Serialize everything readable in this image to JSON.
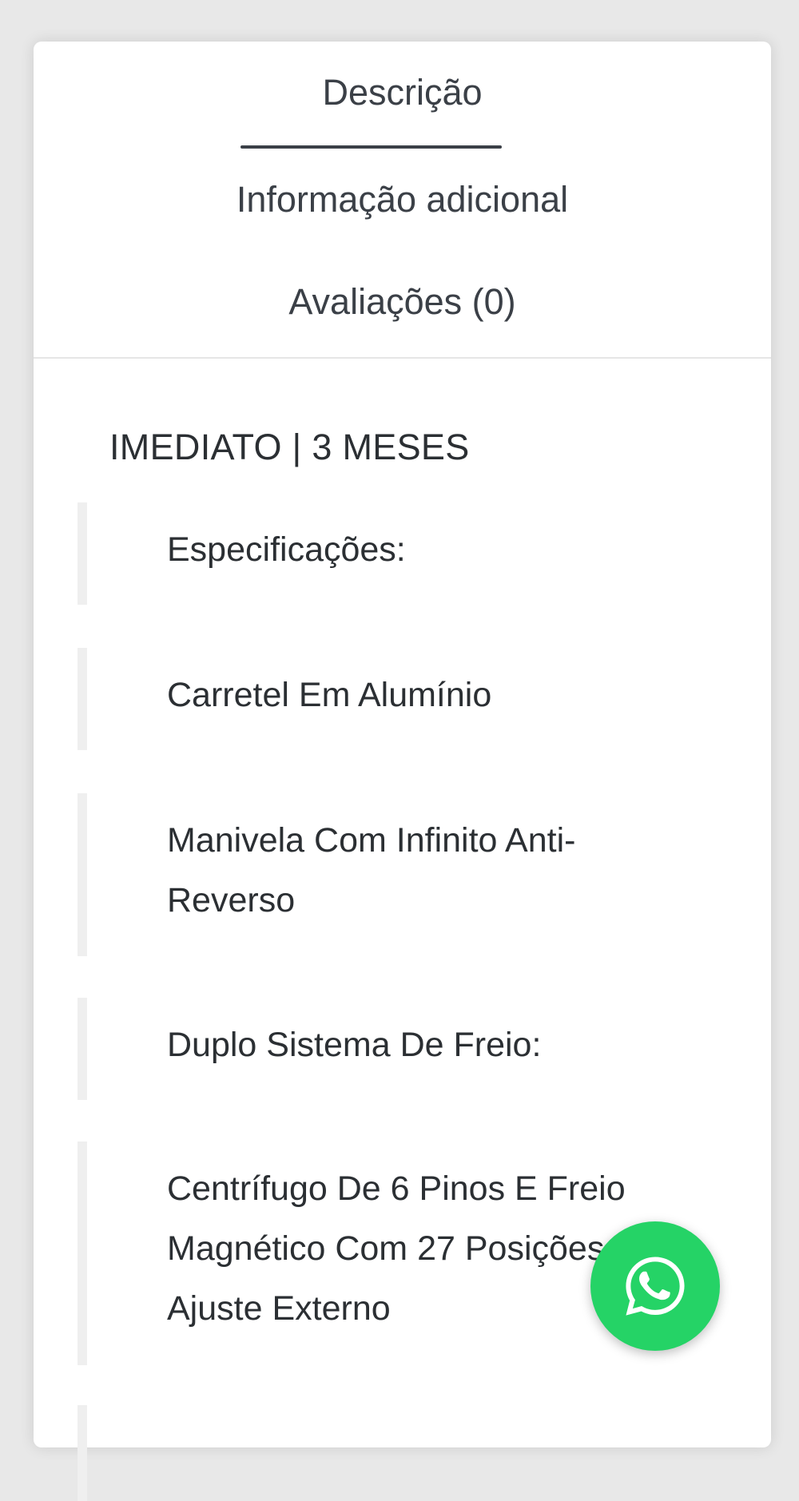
{
  "tabs": {
    "description": "Descrição",
    "additional_info": "Informação adicional",
    "reviews": "Avaliações (0)"
  },
  "content": {
    "headline": "IMEDIATO | 3 MESES",
    "quotes": [
      "Especificações:",
      "Carretel Em Alumínio",
      "Manivela Com Infinito Anti-Reverso",
      "Duplo Sistema De Freio:",
      "Centrífugo De 6 Pinos E Freio Magnético Com 27 Posições De Ajuste Externo"
    ]
  },
  "floating": {
    "icon": "whatsapp-icon",
    "color": "#25d366"
  }
}
